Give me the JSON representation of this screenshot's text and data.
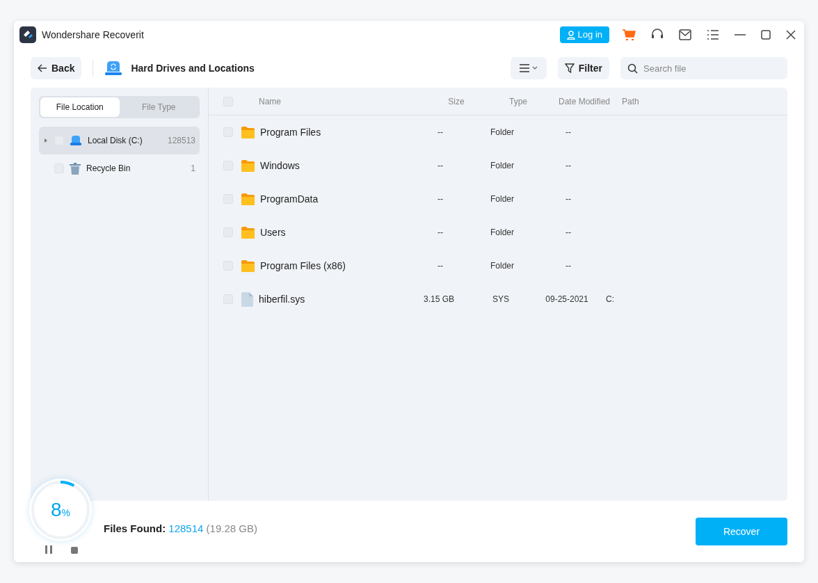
{
  "window": {
    "title": "Wondershare Recoverit",
    "login_button": "Log in"
  },
  "toolbar": {
    "back_button": "Back",
    "location": "Hard Drives and Locations",
    "filter_button": "Filter",
    "search": {
      "placeholder": "Search file"
    }
  },
  "tabs": [
    {
      "label": "File Location",
      "selected": true
    },
    {
      "label": "File Type",
      "selected": false
    }
  ],
  "tree": [
    {
      "kind": "disk",
      "label": "Local Disk (C:)",
      "count": "128513",
      "selected": true,
      "expanded": false,
      "checked": false
    },
    {
      "kind": "trash",
      "label": "Recycle Bin",
      "count": "1",
      "selected": false,
      "checked": false
    }
  ],
  "table": {
    "all_checked": false,
    "columns": [
      "Name",
      "Size",
      "Type",
      "Date Modified",
      "Path"
    ],
    "rows": [
      {
        "kind": "folder",
        "checked": false,
        "cells": [
          "Program Files",
          "--",
          "Folder",
          "--",
          ""
        ]
      },
      {
        "kind": "folder",
        "checked": false,
        "cells": [
          "Windows",
          "--",
          "Folder",
          "--",
          ""
        ]
      },
      {
        "kind": "folder",
        "checked": false,
        "cells": [
          "ProgramData",
          "--",
          "Folder",
          "--",
          ""
        ]
      },
      {
        "kind": "folder",
        "checked": false,
        "cells": [
          "Users",
          "--",
          "Folder",
          "--",
          ""
        ]
      },
      {
        "kind": "folder",
        "checked": false,
        "cells": [
          "Program Files (x86)",
          "--",
          "Folder",
          "--",
          ""
        ]
      },
      {
        "kind": "file",
        "checked": false,
        "cells": [
          "hiberfil.sys",
          "3.15 GB",
          "SYS",
          "09-25-2021",
          "C:"
        ]
      }
    ]
  },
  "footer": {
    "progress": {
      "level": 0.08,
      "percent": "8",
      "unit": "%"
    },
    "files_found_label": "Files Found:",
    "files_found_count": "128514",
    "files_found_size": "(19.28 GB)",
    "recover_button": "Recover"
  }
}
